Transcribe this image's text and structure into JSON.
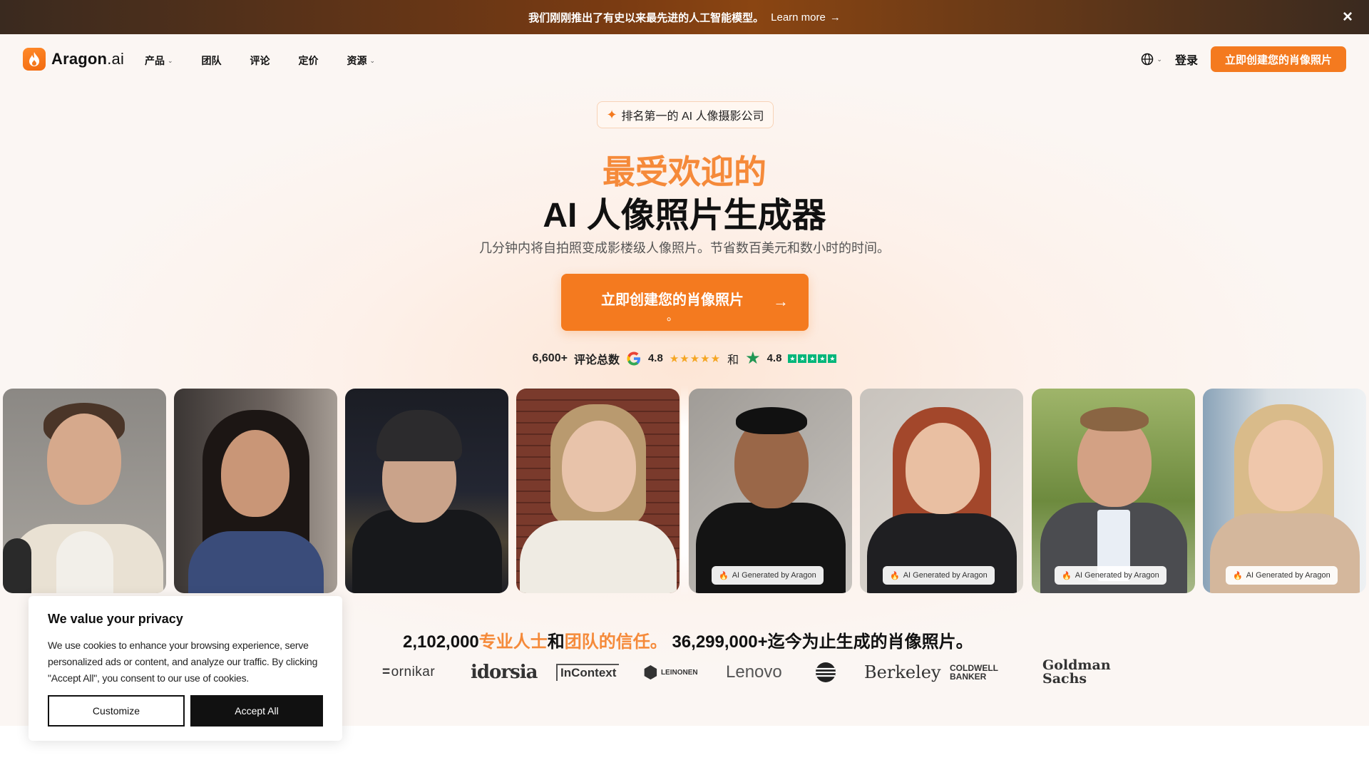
{
  "announcement": {
    "text": "我们刚刚推出了有史以来最先进的人工智能模型。",
    "link_label": "Learn more",
    "arrow_icon": "arrow-right-icon",
    "close_icon": "close-icon"
  },
  "nav": {
    "logo_brand": "Aragon",
    "logo_suffix": ".ai",
    "items": [
      {
        "label": "产品",
        "dropdown": true
      },
      {
        "label": "团队",
        "dropdown": false
      },
      {
        "label": "评论",
        "dropdown": false
      },
      {
        "label": "定价",
        "dropdown": false
      },
      {
        "label": "资源",
        "dropdown": true
      }
    ],
    "language_icon": "globe-icon",
    "login_label": "登录",
    "cta_label": "立即创建您的肖像照片"
  },
  "hero": {
    "badge": "排名第一的 AI 人像摄影公司",
    "title_line1": "最受欢迎的",
    "title_line2": "AI 人像照片生成器",
    "subtitle": "几分钟内将自拍照变成影楼级人像照片。节省数百美元和数小时的时间。",
    "cta_label": "立即创建您的肖像照片",
    "cta_dot": "。",
    "reviews": {
      "count": "6,600+",
      "label": "评论总数",
      "google_rating": "4.8",
      "and": "和",
      "trustpilot_rating": "4.8"
    }
  },
  "photos": {
    "ai_tag": "AI Generated by Aragon",
    "items": [
      {
        "kind": "selfie",
        "name": "selfie-man-jacket"
      },
      {
        "kind": "selfie",
        "name": "selfie-woman-dark-hair"
      },
      {
        "kind": "selfie",
        "name": "selfie-man-beanie"
      },
      {
        "kind": "selfie",
        "name": "selfie-woman-sweater"
      },
      {
        "kind": "generated",
        "name": "generated-man-black-shirt"
      },
      {
        "kind": "generated",
        "name": "generated-woman-red-hair"
      },
      {
        "kind": "generated",
        "name": "generated-man-suit"
      },
      {
        "kind": "generated",
        "name": "generated-woman-blonde"
      }
    ]
  },
  "trust": {
    "count_users": "2,102,000",
    "phrase_pro": "专业人士",
    "and": "和",
    "phrase_team": "团队的信任。",
    "count_photos": "36,299,000+",
    "phrase_photos": "迄今为止生成的肖像照片。",
    "logos": [
      "fornikar",
      "idorsia",
      "InContext",
      "LEINONEN",
      "Lenovo",
      "AT&T",
      "Berkeley",
      "COLDWELL BANKER",
      "Goldman Sachs"
    ]
  },
  "cookie": {
    "title": "We value your privacy",
    "body": "We use cookies to enhance your browsing experience, serve personalized ads or content, and analyze our traffic. By clicking \"Accept All\", you consent to our use of cookies.",
    "customize_label": "Customize",
    "accept_label": "Accept All"
  },
  "colors": {
    "accent": "#f47a1f",
    "accent_text": "#f58a3a",
    "google_blue": "#4285f4",
    "trustpilot_green": "#00b67a",
    "star_yellow": "#f5a623"
  }
}
